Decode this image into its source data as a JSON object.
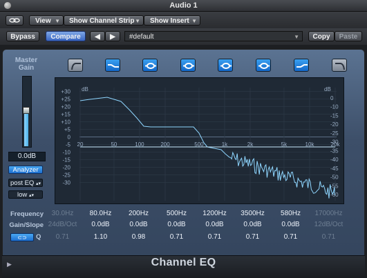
{
  "window": {
    "title": "Audio 1"
  },
  "toolbar": {
    "link_icon": "link-icon",
    "view_label": "View",
    "channel_strip_label": "Show Channel Strip",
    "insert_label": "Show Insert",
    "bypass_label": "Bypass",
    "compare_label": "Compare",
    "preset_value": "#default",
    "copy_label": "Copy",
    "paste_label": "Paste"
  },
  "left": {
    "master_label_1": "Master",
    "master_label_2": "Gain",
    "gain_value": "0.0dB",
    "gain_level_fraction": 0.5,
    "analyzer_label": "Analyzer",
    "analyzer_mode": "post EQ",
    "resolution": "low"
  },
  "graph": {
    "db_left": "dB",
    "db_right": "dB",
    "left_ticks": [
      "+30",
      "+25",
      "+20",
      "+15",
      "+10",
      "+5",
      "0",
      "-5",
      "-10",
      "-15",
      "-20",
      "-25",
      "-30"
    ],
    "right_ticks": [
      "0",
      "-10",
      "-15",
      "-20",
      "-25",
      "-30",
      "-35",
      "-40",
      "-45",
      "-50",
      "-55",
      "-60"
    ],
    "freq_ticks": [
      "20",
      "50",
      "100",
      "200",
      "500",
      "1k",
      "2k",
      "5k",
      "10k",
      "20k"
    ]
  },
  "params": {
    "frequency_label": "Frequency",
    "gain_slope_label": "Gain/Slope",
    "q_label": "Q",
    "frequency": [
      "30.0Hz",
      "80.0Hz",
      "200Hz",
      "500Hz",
      "1200Hz",
      "3500Hz",
      "580Hz",
      "17000Hz"
    ],
    "gain": [
      "24dB/Oct",
      "0.0dB",
      "0.0dB",
      "0.0dB",
      "0.0dB",
      "0.0dB",
      "0.0dB",
      "12dB/Oct"
    ],
    "q": [
      "0.71",
      "1.10",
      "0.98",
      "0.71",
      "0.71",
      "0.71",
      "0.71",
      "0.71"
    ],
    "band_enabled": [
      false,
      true,
      true,
      true,
      true,
      true,
      true,
      false
    ]
  },
  "footer": {
    "plugin_name": "Channel EQ"
  },
  "colors": {
    "accent": "#2b8fe8",
    "curve": "#8fd6ff"
  }
}
